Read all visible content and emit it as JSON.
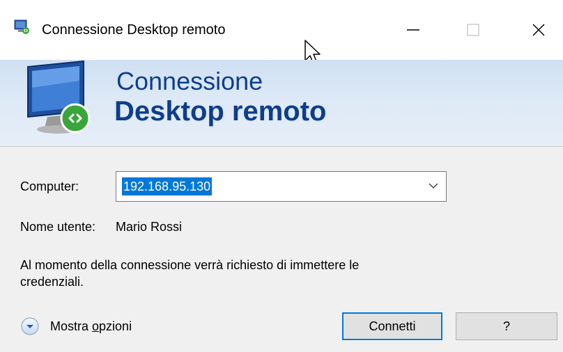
{
  "window": {
    "title": "Connessione Desktop remoto",
    "controls": {
      "minimize": "—",
      "maximize": "☐",
      "close": "✕"
    }
  },
  "banner": {
    "line1": "Connessione",
    "line2": "Desktop remoto",
    "icon": "remote-desktop-monitor-icon"
  },
  "form": {
    "computer_label": "Computer:",
    "computer_value": "192.168.95.130",
    "user_label": "Nome utente:",
    "user_value": "Mario Rossi",
    "notice": "Al momento della connessione verrà richiesto di immettere le credenziali."
  },
  "footer": {
    "options_prefix": "Mostra ",
    "options_access": "o",
    "options_suffix": "pzioni",
    "connect_label": "Connetti",
    "help_label": "?"
  },
  "colors": {
    "accent": "#0078d7",
    "banner_text": "#0f3d8c"
  }
}
